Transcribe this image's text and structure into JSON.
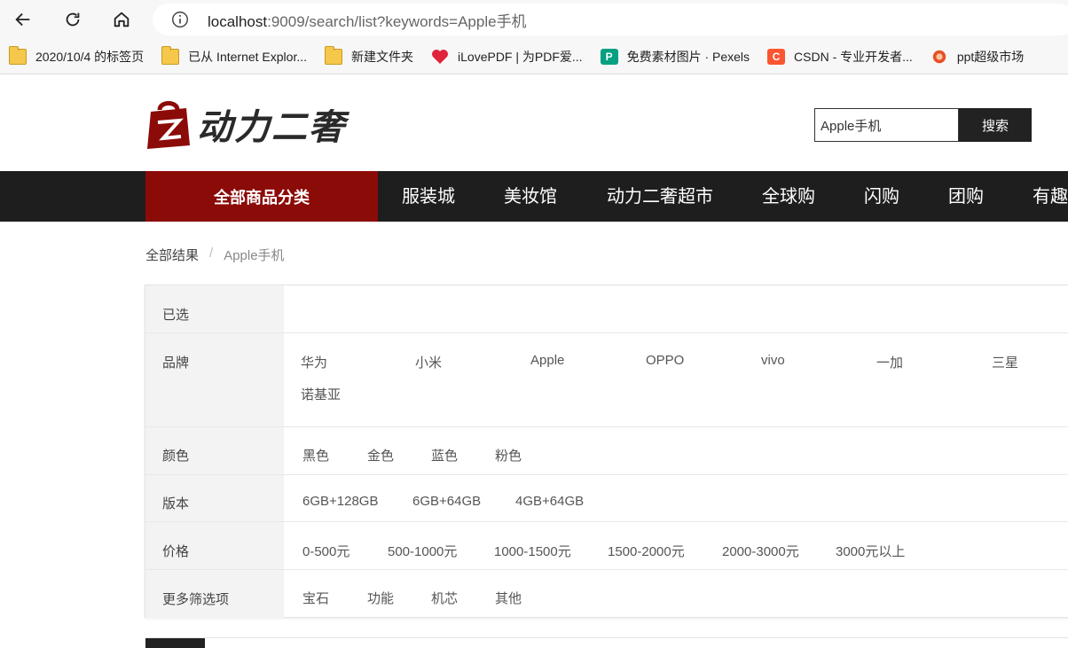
{
  "browser": {
    "url_host": "localhost",
    "url_path": ":9009/search/list?keywords=Apple手机",
    "bookmarks": [
      {
        "label": "2020/10/4 的标签页",
        "icon": "folder-icon"
      },
      {
        "label": "已从 Internet Explor...",
        "icon": "folder-icon"
      },
      {
        "label": "新建文件夹",
        "icon": "folder-icon"
      },
      {
        "label": "iLovePDF | 为PDF爱...",
        "icon": "heart-icon"
      },
      {
        "label": "免费素材图片 · Pexels",
        "icon": "pexels-icon"
      },
      {
        "label": "CSDN - 专业开发者...",
        "icon": "csdn-icon"
      },
      {
        "label": "ppt超级市场",
        "icon": "ppt-icon"
      }
    ]
  },
  "header": {
    "logo_text": "动力二奢",
    "search_value": "Apple手机",
    "search_button": "搜索"
  },
  "nav": {
    "all_categories": "全部商品分类",
    "items": [
      "服装城",
      "美妆馆",
      "动力二奢超市",
      "全球购",
      "闪购",
      "团购",
      "有趣"
    ]
  },
  "breadcrumb": {
    "root": "全部结果",
    "separator": "/",
    "current": "Apple手机"
  },
  "filters": {
    "selected_label": "已选",
    "brand": {
      "label": "品牌",
      "options": [
        "华为",
        "小米",
        "Apple",
        "OPPO",
        "vivo",
        "一加",
        "三星",
        "诺基亚"
      ]
    },
    "color": {
      "label": "颜色",
      "options": [
        "黑色",
        "金色",
        "蓝色",
        "粉色"
      ]
    },
    "version": {
      "label": "版本",
      "options": [
        "6GB+128GB",
        "6GB+64GB",
        "4GB+64GB"
      ]
    },
    "price": {
      "label": "价格",
      "options": [
        "0-500元",
        "500-1000元",
        "1000-1500元",
        "1500-2000元",
        "2000-3000元",
        "3000元以上"
      ]
    },
    "more": {
      "label": "更多筛选项",
      "options": [
        "宝石",
        "功能",
        "机芯",
        "其他"
      ]
    }
  },
  "colors": {
    "brand_red": "#8b0b08",
    "nav_dark": "#1e1e1e"
  }
}
